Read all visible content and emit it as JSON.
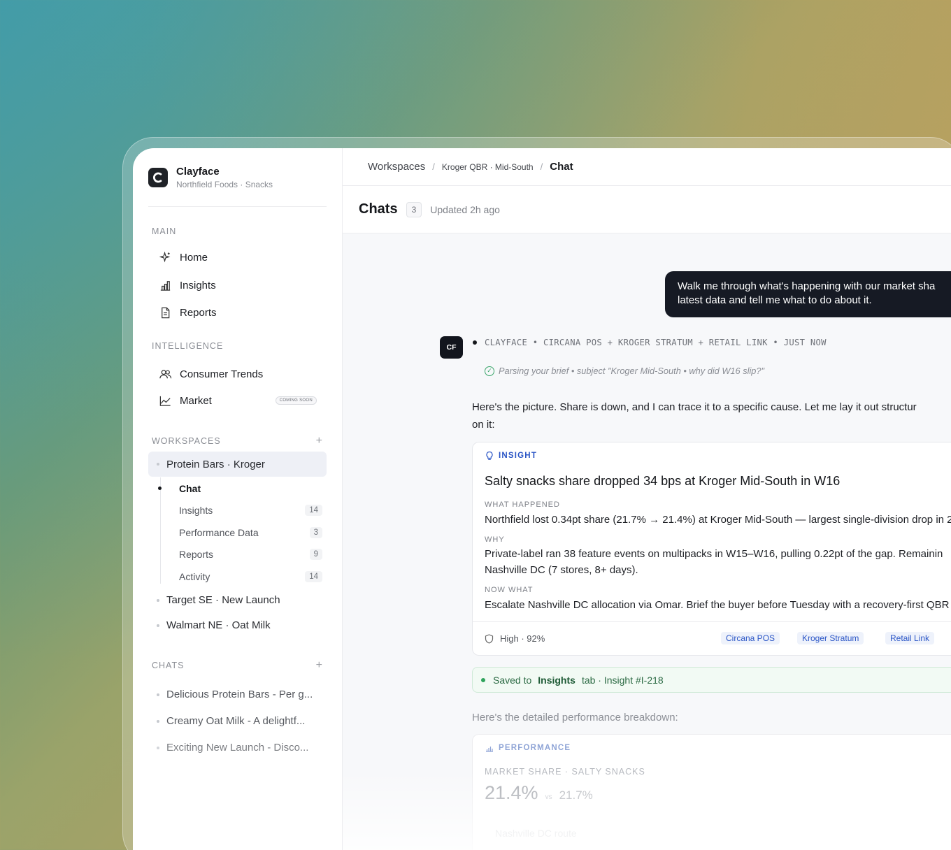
{
  "brand": {
    "name": "Clayface",
    "subtitle": "Northfield Foods · Snacks"
  },
  "sidebar": {
    "main_label": "MAIN",
    "main_items": [
      {
        "label": "Home",
        "icon": "sparkle-icon"
      },
      {
        "label": "Insights",
        "icon": "bar-chart-icon"
      },
      {
        "label": "Reports",
        "icon": "document-icon"
      }
    ],
    "intelligence_label": "INTELLIGENCE",
    "intelligence_items": [
      {
        "label": "Consumer Trends",
        "icon": "users-icon"
      },
      {
        "label": "Market",
        "icon": "line-chart-icon",
        "badge": "COMING SOON"
      }
    ],
    "workspaces_label": "WORKSPACES",
    "workspaces": [
      {
        "label": "Protein Bars · Kroger"
      },
      {
        "label": "Target SE · New Launch"
      },
      {
        "label": "Walmart NE · Oat Milk"
      }
    ],
    "active_workspace_sub": [
      {
        "label": "Chat",
        "count": ""
      },
      {
        "label": "Insights",
        "count": "14"
      },
      {
        "label": "Performance Data",
        "count": "3"
      },
      {
        "label": "Reports",
        "count": "9"
      },
      {
        "label": "Activity",
        "count": "14"
      }
    ],
    "chats_label": "CHATS",
    "chats": [
      {
        "label": "Delicious Protein Bars - Per g..."
      },
      {
        "label": "Creamy Oat Milk - A delightf..."
      },
      {
        "label": "Exciting New Launch - Disco..."
      }
    ]
  },
  "breadcrumb": {
    "root": "Workspaces",
    "middle": "Kroger QBR · Mid-South",
    "current": "Chat"
  },
  "header": {
    "title": "Chats",
    "count": "3",
    "updated": "Updated 2h ago"
  },
  "conversation": {
    "user_message_line1": "Walk me through what's happening with our market sha",
    "user_message_line2": "latest data and tell me what to do about it.",
    "avatar": "CF",
    "meta": "CLAYFACE • CIRCANA POS + KROGER STRATUM + RETAIL LINK • JUST NOW",
    "parsing": "Parsing your brief • subject \"Kroger Mid-South • why did W16 slip?\"",
    "intro_line1": "Here's the picture. Share is down, and I can trace it to a specific cause. Let me lay it out structur",
    "intro_line2": "on it:",
    "insight": {
      "tag": "INSIGHT",
      "title": "Salty snacks share dropped 34 bps at Kroger Mid-South in W16",
      "what_happened_label": "WHAT HAPPENED",
      "what_happened": "Northfield lost 0.34pt share (21.7% → 21.4%) at Kroger Mid-South — largest single-division drop in 2",
      "why_label": "WHY",
      "why_line1": "Private-label ran 38 feature events on multipacks in W15–W16, pulling 0.22pt of the gap. Remainin",
      "why_line2": "Nashville DC (7 stores, 8+ days).",
      "now_what_label": "NOW WHAT",
      "now_what": "Escalate Nashville DC allocation via Omar. Brief the buyer before Tuesday with a recovery-first QBR",
      "confidence": "High · 92%",
      "sources": [
        "Circana POS",
        "Kroger Stratum",
        "Retail Link"
      ]
    },
    "saved": {
      "prefix": "Saved to",
      "target": "Insights",
      "suffix": "tab · Insight #I-218"
    },
    "detail_intro": "Here's the detailed performance breakdown:",
    "performance": {
      "tag": "PERFORMANCE",
      "subtitle": "MARKET SHARE · SALTY SNACKS",
      "value": "21.4%",
      "vs": "vs",
      "prior": "21.7%",
      "route": "Nashville DC route"
    }
  },
  "colors": {
    "accent": "#2a55c6",
    "dark": "#161a24",
    "success": "#2fa35c"
  }
}
